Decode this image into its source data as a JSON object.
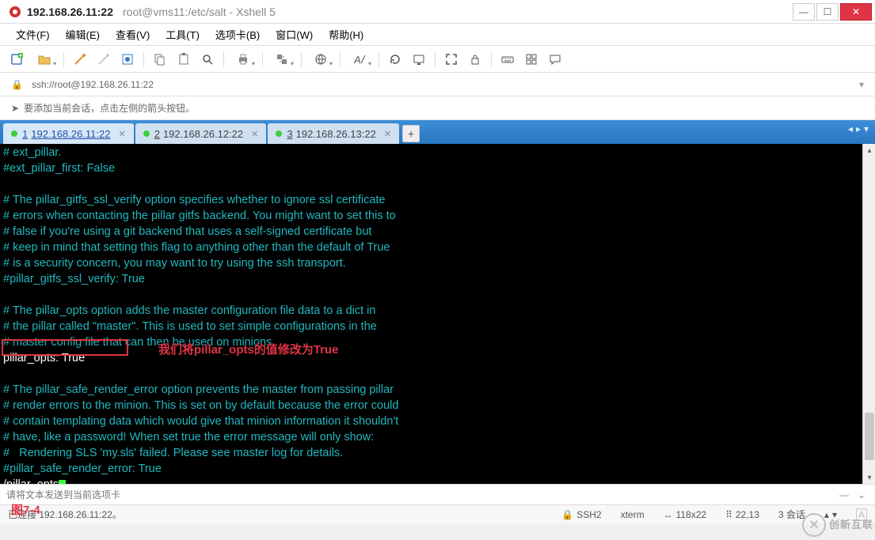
{
  "title": {
    "address": "192.168.26.11:22",
    "subtitle": "root@vms11:/etc/salt - Xshell 5"
  },
  "menu": {
    "file": "文件(F)",
    "edit": "编辑(E)",
    "view": "查看(V)",
    "tools": "工具(T)",
    "tabs": "选项卡(B)",
    "window": "窗口(W)",
    "help": "帮助(H)"
  },
  "addressbar": {
    "url": "ssh://root@192.168.26.11:22"
  },
  "infobar": {
    "msg": "要添加当前会话，点击左侧的箭头按钮。"
  },
  "tabs": [
    {
      "idx": "1",
      "label": "192.168.26.11:22",
      "active": true
    },
    {
      "idx": "2",
      "label": "192.168.26.12:22",
      "active": false
    },
    {
      "idx": "3",
      "label": "192.168.26.13:22",
      "active": false
    }
  ],
  "terminal": {
    "lines": [
      {
        "cls": "term-comment",
        "text": "# ext_pillar."
      },
      {
        "cls": "term-comment",
        "text": "#ext_pillar_first: False"
      },
      {
        "cls": "term-comment",
        "text": ""
      },
      {
        "cls": "term-comment",
        "text": "# The pillar_gitfs_ssl_verify option specifies whether to ignore ssl certificate"
      },
      {
        "cls": "term-comment",
        "text": "# errors when contacting the pillar gitfs backend. You might want to set this to"
      },
      {
        "cls": "term-comment",
        "text": "# false if you're using a git backend that uses a self-signed certificate but"
      },
      {
        "cls": "term-comment",
        "text": "# keep in mind that setting this flag to anything other than the default of True"
      },
      {
        "cls": "term-comment",
        "text": "# is a security concern, you may want to try using the ssh transport."
      },
      {
        "cls": "term-comment",
        "text": "#pillar_gitfs_ssl_verify: True"
      },
      {
        "cls": "term-comment",
        "text": ""
      },
      {
        "cls": "term-comment",
        "text": "# The pillar_opts option adds the master configuration file data to a dict in"
      },
      {
        "cls": "term-comment",
        "text": "# the pillar called \"master\". This is used to set simple configurations in the"
      },
      {
        "cls": "term-comment",
        "text": "# master config file that can then be used on minions."
      },
      {
        "cls": "term-white",
        "text": "pillar_opts: True"
      },
      {
        "cls": "term-comment",
        "text": ""
      },
      {
        "cls": "term-comment",
        "text": "# The pillar_safe_render_error option prevents the master from passing pillar"
      },
      {
        "cls": "term-comment",
        "text": "# render errors to the minion. This is set on by default because the error could"
      },
      {
        "cls": "term-comment",
        "text": "# contain templating data which would give that minion information it shouldn't"
      },
      {
        "cls": "term-comment",
        "text": "# have, like a password! When set true the error message will only show:"
      },
      {
        "cls": "term-comment",
        "text": "#   Rendering SLS 'my.sls' failed. Please see master log for details."
      },
      {
        "cls": "term-comment",
        "text": "#pillar_safe_render_error: True"
      }
    ],
    "search_prefix": "/",
    "search_query": "pillar_opts"
  },
  "annotation": {
    "text": "我们将pillar_opts的值修改为True"
  },
  "quickbar": {
    "placeholder": "请将文本发送到当前选项卡"
  },
  "statusbar": {
    "connected": "已连接 192.168.26.11:22。",
    "proto": "SSH2",
    "termtype": "xterm",
    "size": "118x22",
    "cursor": "22,13",
    "sessions": "3 会话"
  },
  "figlabel": "图7-4",
  "watermark": {
    "text": "创新互联"
  }
}
